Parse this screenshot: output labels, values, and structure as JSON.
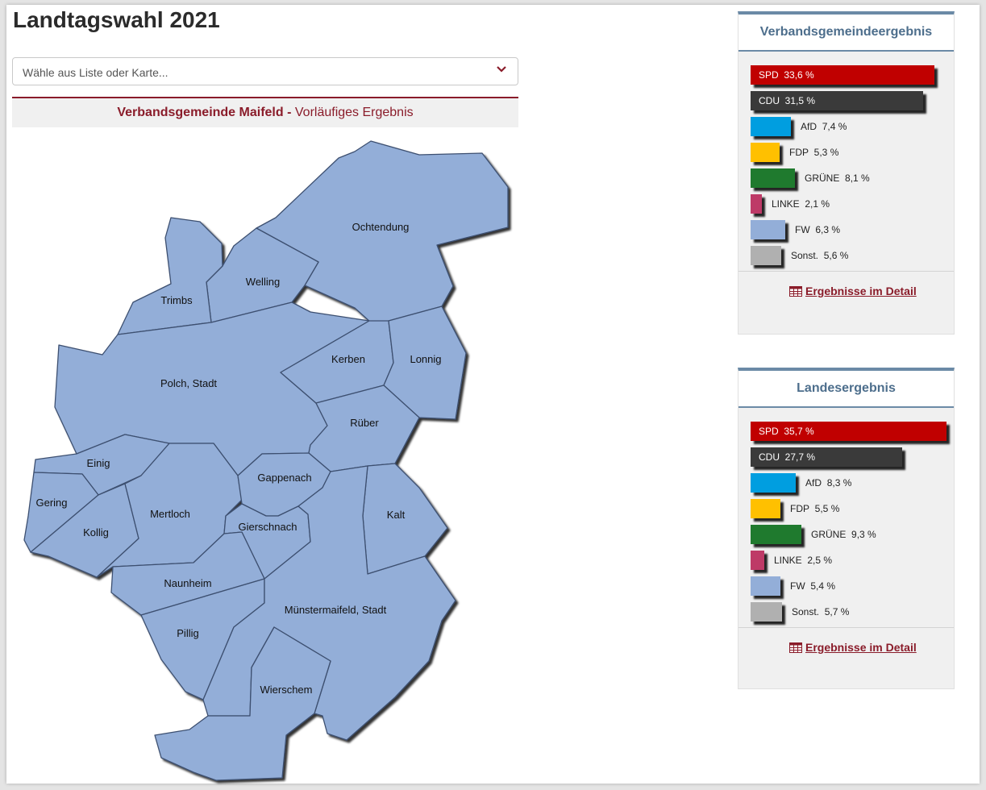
{
  "page": {
    "title": "Landtagswahl 2021",
    "select_placeholder": "Wähle aus Liste oder Karte...",
    "header_bold": "Verbandsgemeinde Maifeld -",
    "header_rest": "Vorläufiges Ergebnis"
  },
  "map": {
    "fill": "#93aed8",
    "stroke": "#3d5070",
    "regions": [
      {
        "name": "Ochtendung"
      },
      {
        "name": "Welling"
      },
      {
        "name": "Trimbs"
      },
      {
        "name": "Polch, Stadt"
      },
      {
        "name": "Kerben"
      },
      {
        "name": "Lonnig"
      },
      {
        "name": "Rüber"
      },
      {
        "name": "Einig"
      },
      {
        "name": "Gering"
      },
      {
        "name": "Kollig"
      },
      {
        "name": "Mertloch"
      },
      {
        "name": "Gappenach"
      },
      {
        "name": "Gierschnach"
      },
      {
        "name": "Kalt"
      },
      {
        "name": "Naunheim"
      },
      {
        "name": "Pillig"
      },
      {
        "name": "Münstermaifeld, Stadt"
      },
      {
        "name": "Wierschem"
      }
    ]
  },
  "panels": {
    "vg": {
      "title": "Verbandsgemeindeergebnis",
      "link": "Ergebnisse im Detail",
      "results": [
        {
          "party": "SPD",
          "value": "33,6 %",
          "pct": 33.6,
          "color": "#c00000",
          "label_inside": true
        },
        {
          "party": "CDU",
          "value": "31,5 %",
          "pct": 31.5,
          "color": "#3a3a3a",
          "label_inside": true
        },
        {
          "party": "AfD",
          "value": "7,4 %",
          "pct": 7.4,
          "color": "#009ee0",
          "label_inside": false
        },
        {
          "party": "FDP",
          "value": "5,3 %",
          "pct": 5.3,
          "color": "#ffc000",
          "label_inside": false
        },
        {
          "party": "GRÜNE",
          "value": "8,1 %",
          "pct": 8.1,
          "color": "#1f7a2e",
          "label_inside": false
        },
        {
          "party": "LINKE",
          "value": "2,1 %",
          "pct": 2.1,
          "color": "#be3a67",
          "label_inside": false
        },
        {
          "party": "FW",
          "value": "6,3 %",
          "pct": 6.3,
          "color": "#93aed8",
          "label_inside": false
        },
        {
          "party": "Sonst.",
          "value": "5,6 %",
          "pct": 5.6,
          "color": "#b0b0b0",
          "label_inside": false
        }
      ]
    },
    "land": {
      "title": "Landesergebnis",
      "link": "Ergebnisse im Detail",
      "results": [
        {
          "party": "SPD",
          "value": "35,7 %",
          "pct": 35.7,
          "color": "#c00000",
          "label_inside": true
        },
        {
          "party": "CDU",
          "value": "27,7 %",
          "pct": 27.7,
          "color": "#3a3a3a",
          "label_inside": true
        },
        {
          "party": "AfD",
          "value": "8,3 %",
          "pct": 8.3,
          "color": "#009ee0",
          "label_inside": false
        },
        {
          "party": "FDP",
          "value": "5,5 %",
          "pct": 5.5,
          "color": "#ffc000",
          "label_inside": false
        },
        {
          "party": "GRÜNE",
          "value": "9,3 %",
          "pct": 9.3,
          "color": "#1f7a2e",
          "label_inside": false
        },
        {
          "party": "LINKE",
          "value": "2,5 %",
          "pct": 2.5,
          "color": "#be3a67",
          "label_inside": false
        },
        {
          "party": "FW",
          "value": "5,4 %",
          "pct": 5.4,
          "color": "#93aed8",
          "label_inside": false
        },
        {
          "party": "Sonst.",
          "value": "5,7 %",
          "pct": 5.7,
          "color": "#b0b0b0",
          "label_inside": false
        }
      ]
    }
  }
}
